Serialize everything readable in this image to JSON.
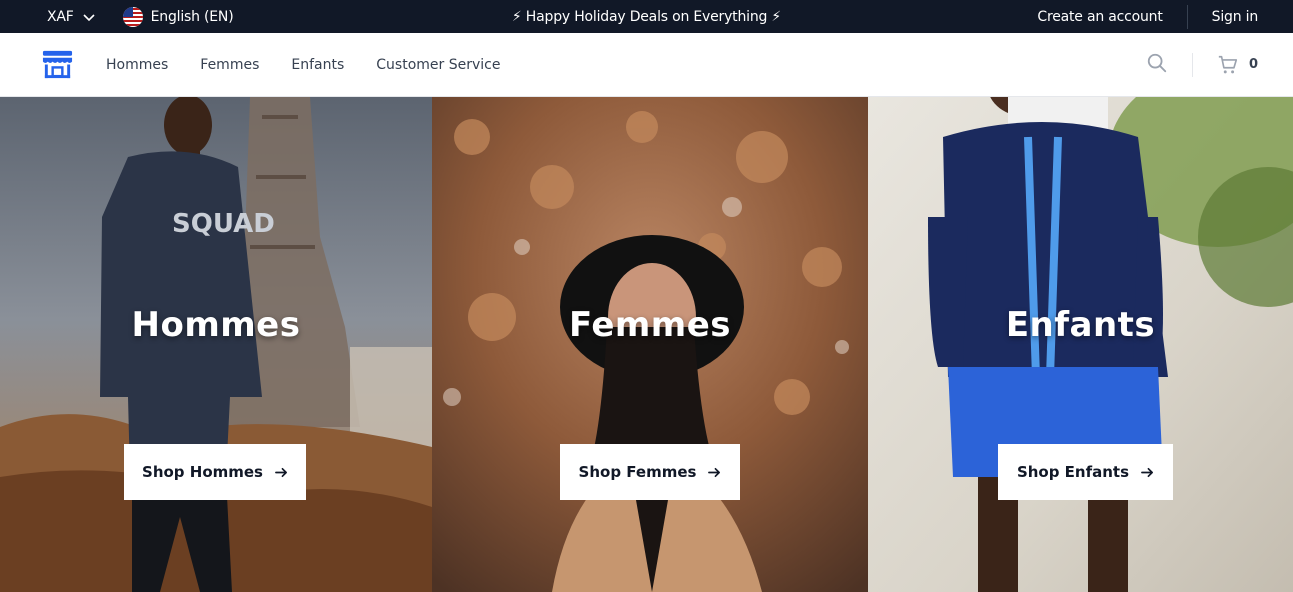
{
  "topbar": {
    "currency": "XAF",
    "language": "English (EN)",
    "promo": "⚡ Happy Holiday Deals on Everything ⚡",
    "create_account": "Create an account",
    "sign_in": "Sign in"
  },
  "nav": {
    "items": [
      "Hommes",
      "Femmes",
      "Enfants",
      "Customer Service"
    ],
    "cart_count": "0"
  },
  "hero": {
    "panels": [
      {
        "title": "Hommes",
        "cta": "Shop Hommes"
      },
      {
        "title": "Femmes",
        "cta": "Shop Femmes"
      },
      {
        "title": "Enfants",
        "cta": "Shop Enfants"
      }
    ]
  },
  "colors": {
    "topbar_bg": "#111827",
    "accent": "#2563eb"
  },
  "icons": [
    "chevron-down-icon",
    "us-flag-icon",
    "store-logo-icon",
    "search-icon",
    "cart-icon",
    "arrow-right-icon"
  ]
}
